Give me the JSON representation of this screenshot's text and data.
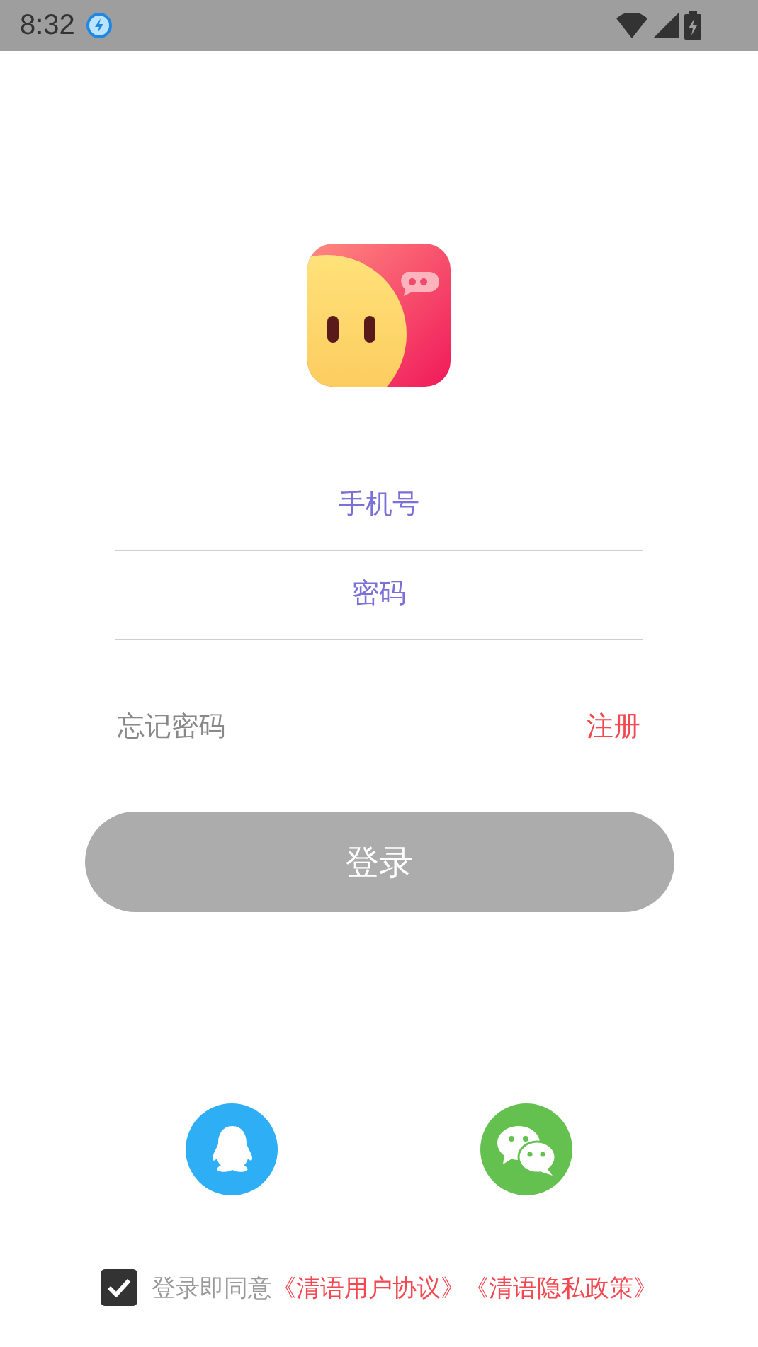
{
  "status_bar": {
    "time": "8:32"
  },
  "form": {
    "phone": {
      "placeholder": "手机号"
    },
    "password": {
      "placeholder": "密码"
    }
  },
  "links": {
    "forgot": "忘记密码",
    "register": "注册"
  },
  "login_button": {
    "label": "登录",
    "disabled": true
  },
  "social": [
    {
      "kind": "qq",
      "color": "#2eaff5"
    },
    {
      "kind": "wechat",
      "color": "#65c14f"
    }
  ],
  "agreement": {
    "checked": true,
    "text": "登录即同意",
    "links": [
      "《清语用户协议》",
      "《清语隐私政策》"
    ]
  }
}
